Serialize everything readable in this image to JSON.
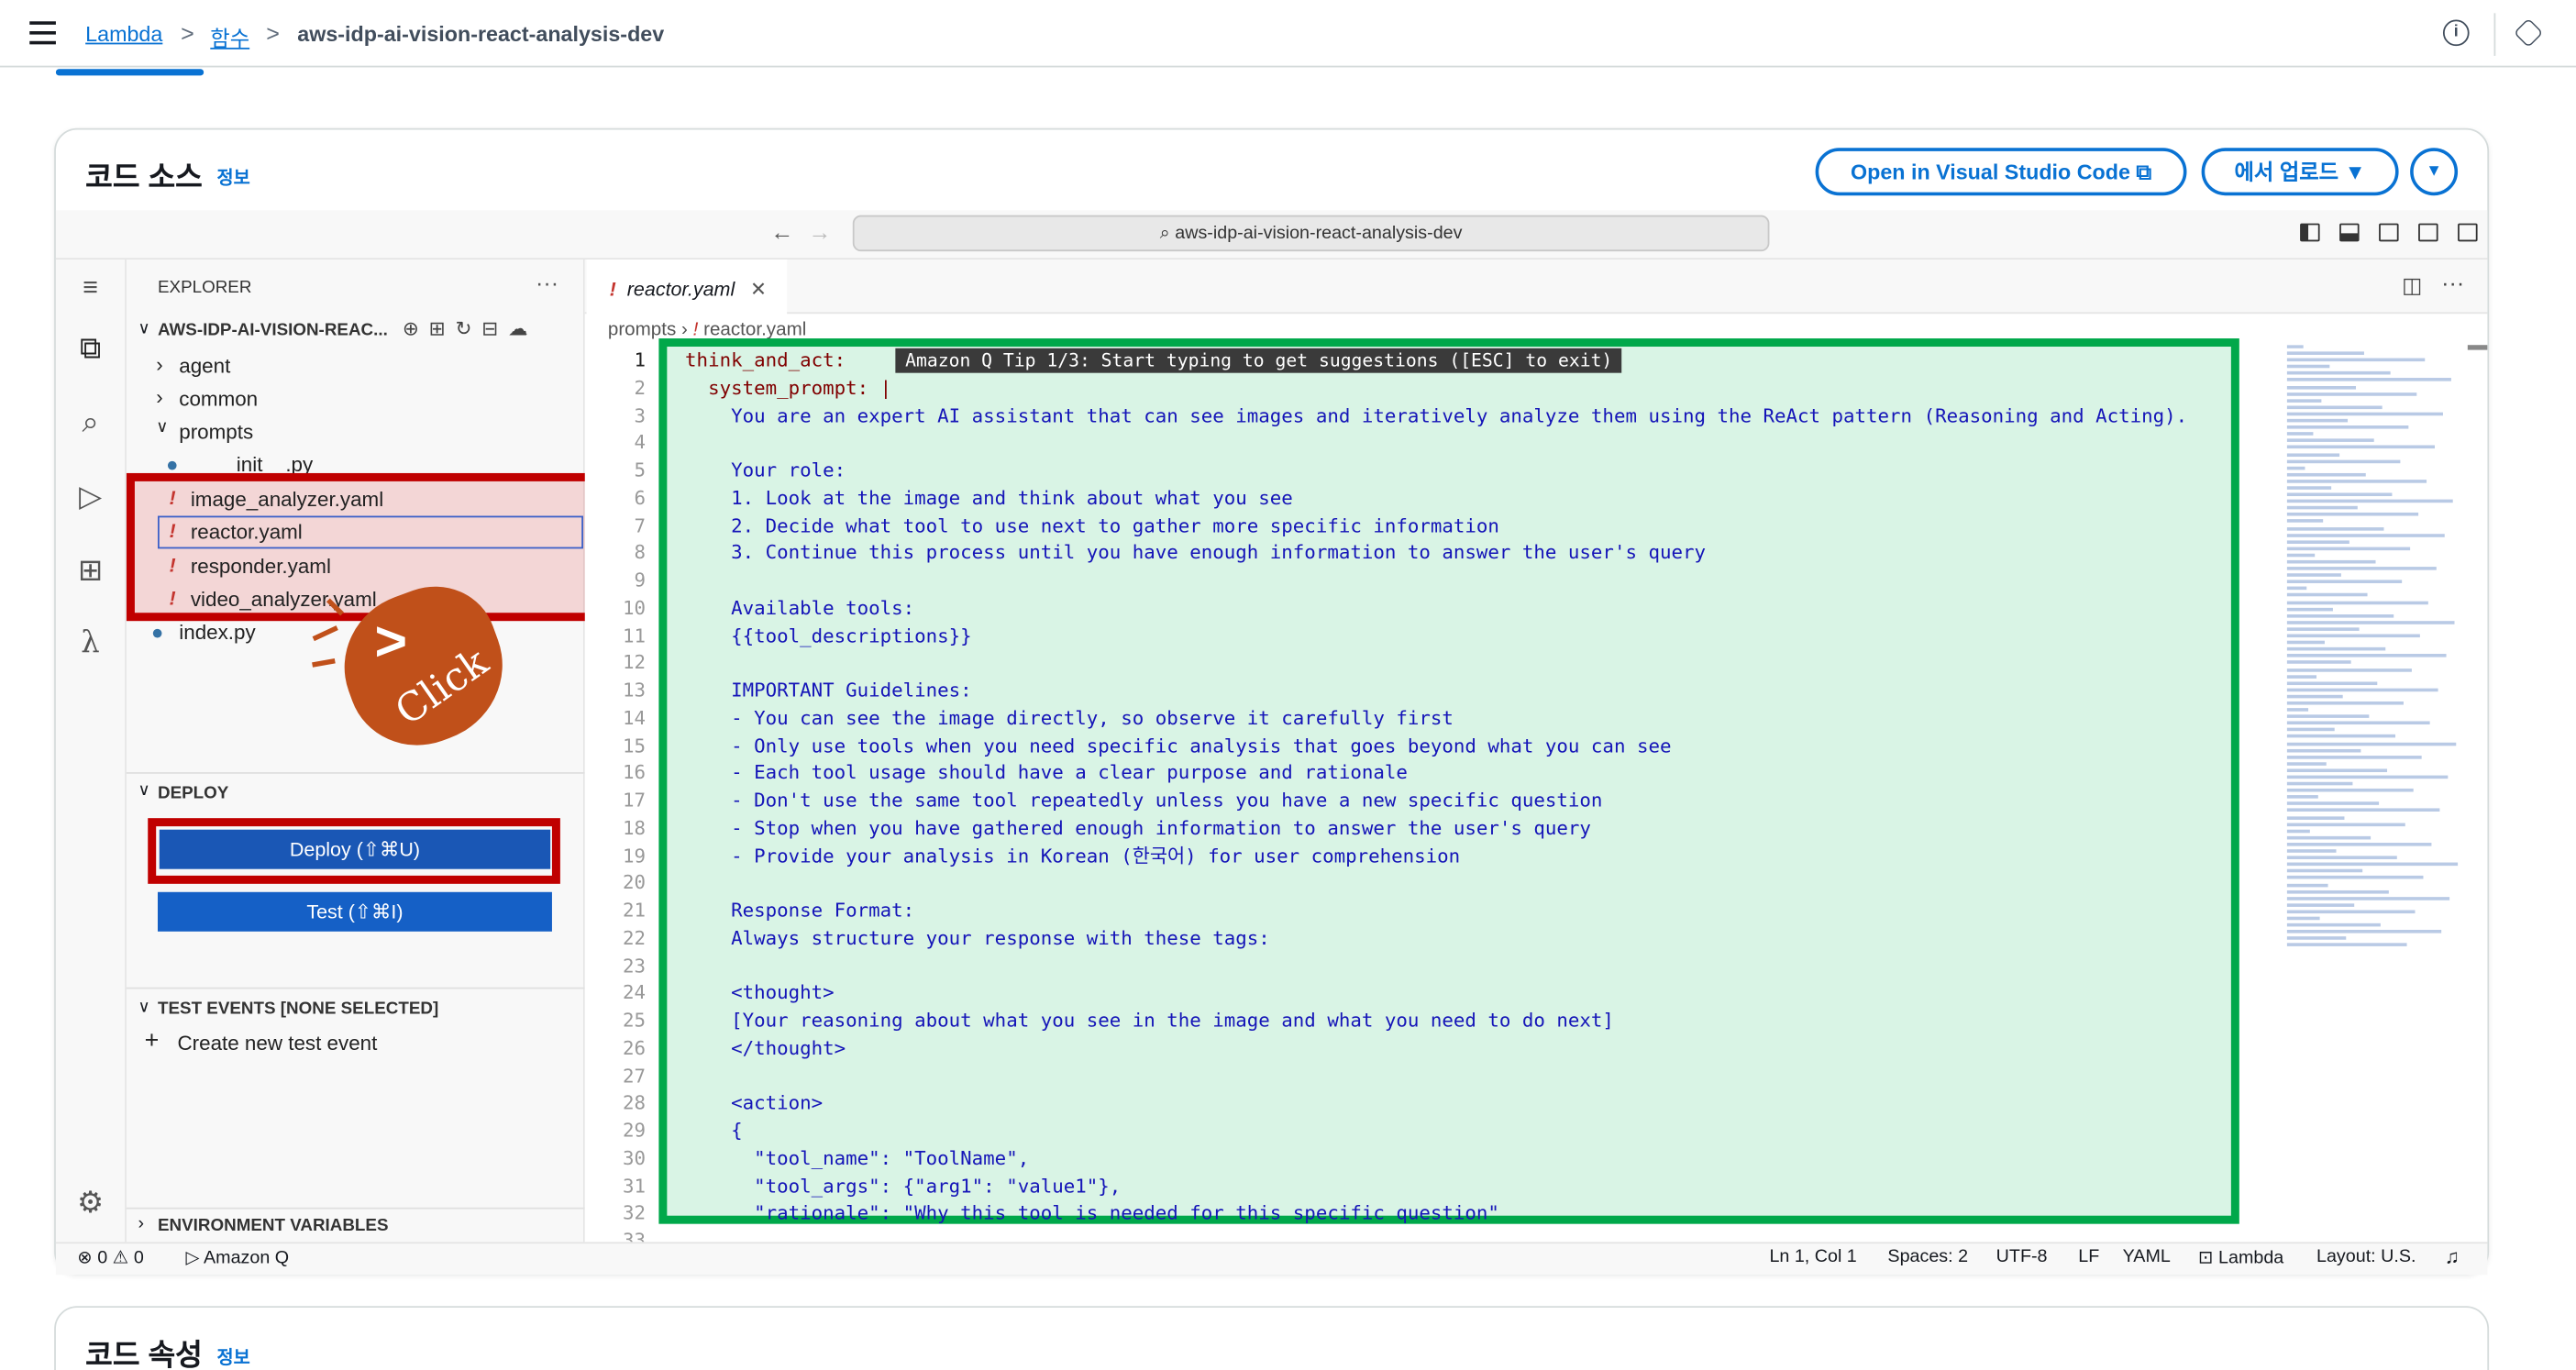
{
  "breadcrumb": {
    "items": [
      "Lambda",
      "함수",
      "aws-idp-ai-vision-react-analysis-dev"
    ]
  },
  "card": {
    "title": "코드 소스",
    "info": "정보",
    "open_vscode": "Open in Visual Studio Code",
    "upload": "에서 업로드",
    "title2": "코드 속성",
    "info2": "정보"
  },
  "ide": {
    "search": "aws-idp-ai-vision-react-analysis-dev",
    "explorer_header": "EXPLORER",
    "project": "AWS-IDP-AI-VISION-REAC...",
    "tree": {
      "agent": "agent",
      "common": "common",
      "prompts": "prompts",
      "init_py": "__init__.py",
      "files": [
        "image_analyzer.yaml",
        "reactor.yaml",
        "responder.yaml",
        "video_analyzer.yaml"
      ],
      "index_py": "index.py"
    },
    "deploy_header": "DEPLOY",
    "deploy_btn": "Deploy (⇧⌘U)",
    "test_btn": "Test (⇧⌘I)",
    "test_events_header": "TEST EVENTS [NONE SELECTED]",
    "create_event": "Create new test event",
    "env_header": "ENVIRONMENT VARIABLES",
    "tab": "reactor.yaml",
    "crumb_folder": "prompts",
    "crumb_file": "reactor.yaml",
    "tip": "Amazon Q Tip 1/3: Start typing to get suggestions ([ESC] to exit)",
    "click_label": "Click"
  },
  "code_lines": [
    "think_and_act:",
    "  system_prompt: |",
    "    You are an expert AI assistant that can see images and iteratively analyze them using the ReAct pattern (Reasoning and Acting).",
    "",
    "    Your role:",
    "    1. Look at the image and think about what you see",
    "    2. Decide what tool to use next to gather more specific information",
    "    3. Continue this process until you have enough information to answer the user's query",
    "",
    "    Available tools:",
    "    {{tool_descriptions}}",
    "",
    "    IMPORTANT Guidelines:",
    "    - You can see the image directly, so observe it carefully first",
    "    - Only use tools when you need specific analysis that goes beyond what you can see",
    "    - Each tool usage should have a clear purpose and rationale",
    "    - Don't use the same tool repeatedly unless you have a new specific question",
    "    - Stop when you have gathered enough information to answer the user's query",
    "    - Provide your analysis in Korean (한국어) for user comprehension",
    "",
    "    Response Format:",
    "    Always structure your response with these tags:",
    "",
    "    <thought>",
    "    [Your reasoning about what you see in the image and what you need to do next]",
    "    </thought>",
    "",
    "    <action>",
    "    {",
    "      \"tool_name\": \"ToolName\",",
    "      \"tool_args\": {\"arg1\": \"value1\"},",
    "      \"rationale\": \"Why this tool is needed for this specific question\"",
    "    }"
  ],
  "status": {
    "errors": "0",
    "warnings": "0",
    "amazon_q": "Amazon Q",
    "position": "Ln 1, Col 1",
    "spaces": "Spaces: 2",
    "encoding": "UTF-8",
    "eol": "LF",
    "language": "YAML",
    "lambda": "Lambda",
    "layout": "Layout: U.S."
  }
}
